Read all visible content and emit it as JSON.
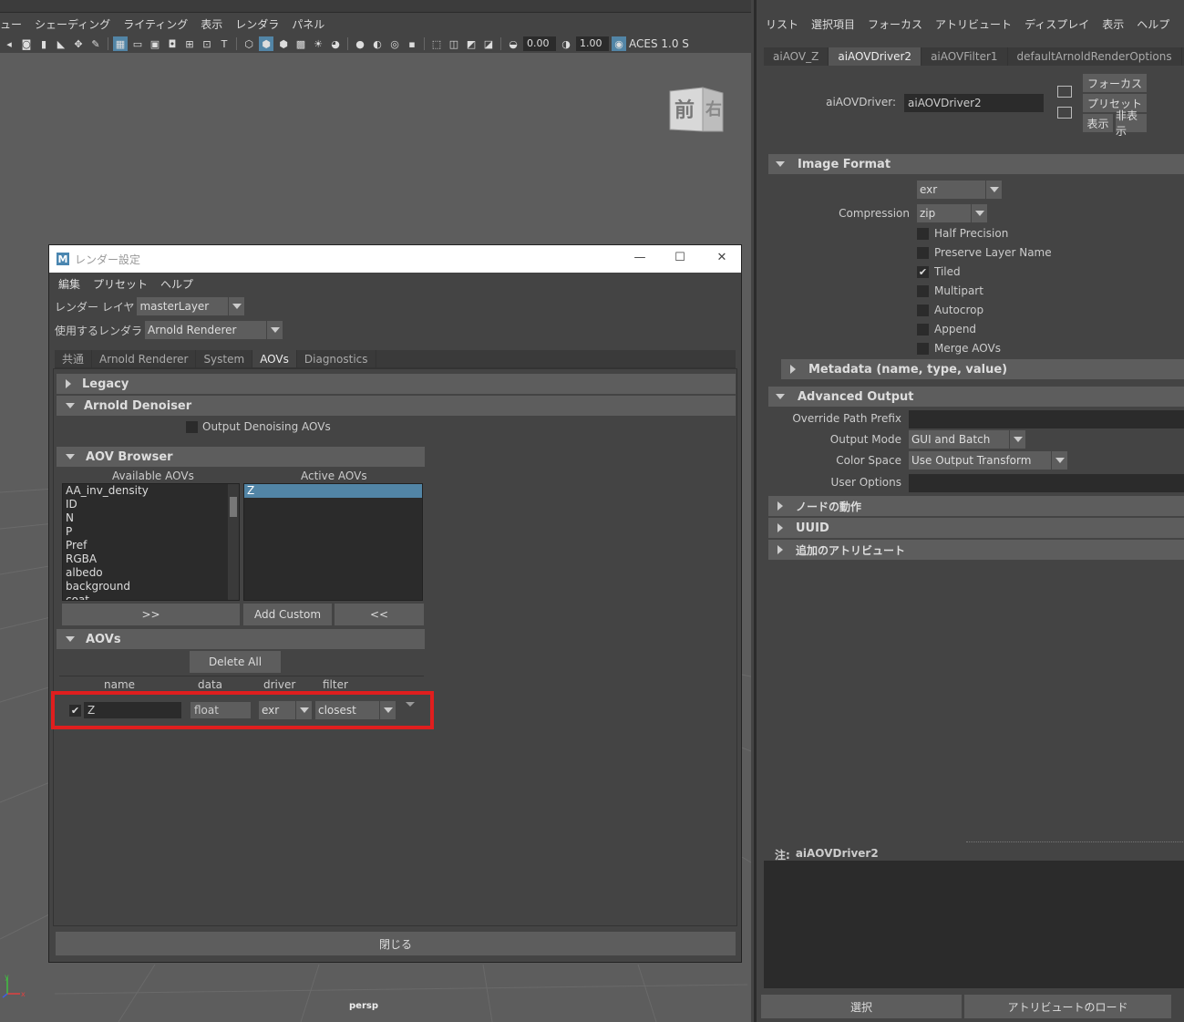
{
  "viewport": {
    "menu": [
      "ュー",
      "シェーディング",
      "ライティング",
      "表示",
      "レンダラ",
      "パネル"
    ],
    "toolbar": {
      "field1": "0.00",
      "field2": "1.00",
      "colorspace": "ACES 1.0 S"
    },
    "viewcube": {
      "front": "前",
      "right": "右"
    },
    "camera_label": "persp",
    "axis": {
      "x": "x",
      "y": "y",
      "z": "z"
    }
  },
  "render_settings": {
    "title": "レンダー設定",
    "logo": "M",
    "menu": [
      "編集",
      "プリセット",
      "ヘルプ"
    ],
    "render_layer_label": "レンダー レイヤ",
    "render_layer_value": "masterLayer",
    "renderer_label": "使用するレンダラ",
    "renderer_value": "Arnold Renderer",
    "tabs": [
      "共通",
      "Arnold Renderer",
      "System",
      "AOVs",
      "Diagnostics"
    ],
    "active_tab": "AOVs",
    "sections": {
      "legacy": "Legacy",
      "denoiser": "Arnold Denoiser",
      "denoise_option": "Output Denoising AOVs",
      "browser": "AOV Browser",
      "aovs": "AOVs"
    },
    "browser": {
      "available_label": "Available AOVs",
      "active_label": "Active AOVs",
      "available": [
        "AA_inv_density",
        "ID",
        "N",
        "P",
        "Pref",
        "RGBA",
        "albedo",
        "background",
        "coat"
      ],
      "active": [
        "Z"
      ],
      "add_button": ">>",
      "custom_button": "Add Custom",
      "remove_button": "<<"
    },
    "delete_all": "Delete All",
    "columns": [
      "name",
      "data",
      "driver",
      "filter"
    ],
    "aov_row": {
      "enabled": true,
      "name": "Z",
      "data": "float",
      "driver": "exr",
      "filter": "closest"
    },
    "close_button": "閉じる"
  },
  "attribute_editor": {
    "menu": [
      "リスト",
      "選択項目",
      "フォーカス",
      "アトリビュート",
      "ディスプレイ",
      "表示",
      "ヘルプ"
    ],
    "tabs": [
      "aiAOV_Z",
      "aiAOVDriver2",
      "aiAOVFilter1",
      "defaultArnoldRenderOptions"
    ],
    "active_tab": "aiAOVDriver2",
    "node_label": "aiAOVDriver:",
    "node_value": "aiAOVDriver2",
    "buttons": {
      "focus": "フォーカス",
      "preset": "プリセット",
      "show": "表示",
      "hide": "非表示"
    },
    "image_format": {
      "header": "Image Format",
      "format_value": "exr",
      "compression_label": "Compression",
      "compression_value": "zip",
      "checkboxes": [
        {
          "label": "Half Precision",
          "checked": false
        },
        {
          "label": "Preserve Layer Name",
          "checked": false
        },
        {
          "label": "Tiled",
          "checked": true
        },
        {
          "label": "Multipart",
          "checked": false
        },
        {
          "label": "Autocrop",
          "checked": false
        },
        {
          "label": "Append",
          "checked": false
        },
        {
          "label": "Merge AOVs",
          "checked": false
        }
      ],
      "metadata_header": "Metadata (name, type, value)"
    },
    "advanced_output": {
      "header": "Advanced Output",
      "override_label": "Override Path Prefix",
      "override_value": "",
      "output_mode_label": "Output Mode",
      "output_mode_value": "GUI and Batch",
      "color_space_label": "Color Space",
      "color_space_value": "Use Output Transform",
      "user_options_label": "User Options",
      "user_options_value": ""
    },
    "collapsed_sections": [
      "ノードの動作",
      "UUID",
      "追加のアトリビュート"
    ],
    "notes_label": "注:",
    "notes_node": "aiAOVDriver2",
    "bottom_buttons": [
      "選択",
      "アトリビュートのロード"
    ]
  },
  "colors": {
    "highlight": "#e01e1e",
    "selection": "#5285a6"
  }
}
